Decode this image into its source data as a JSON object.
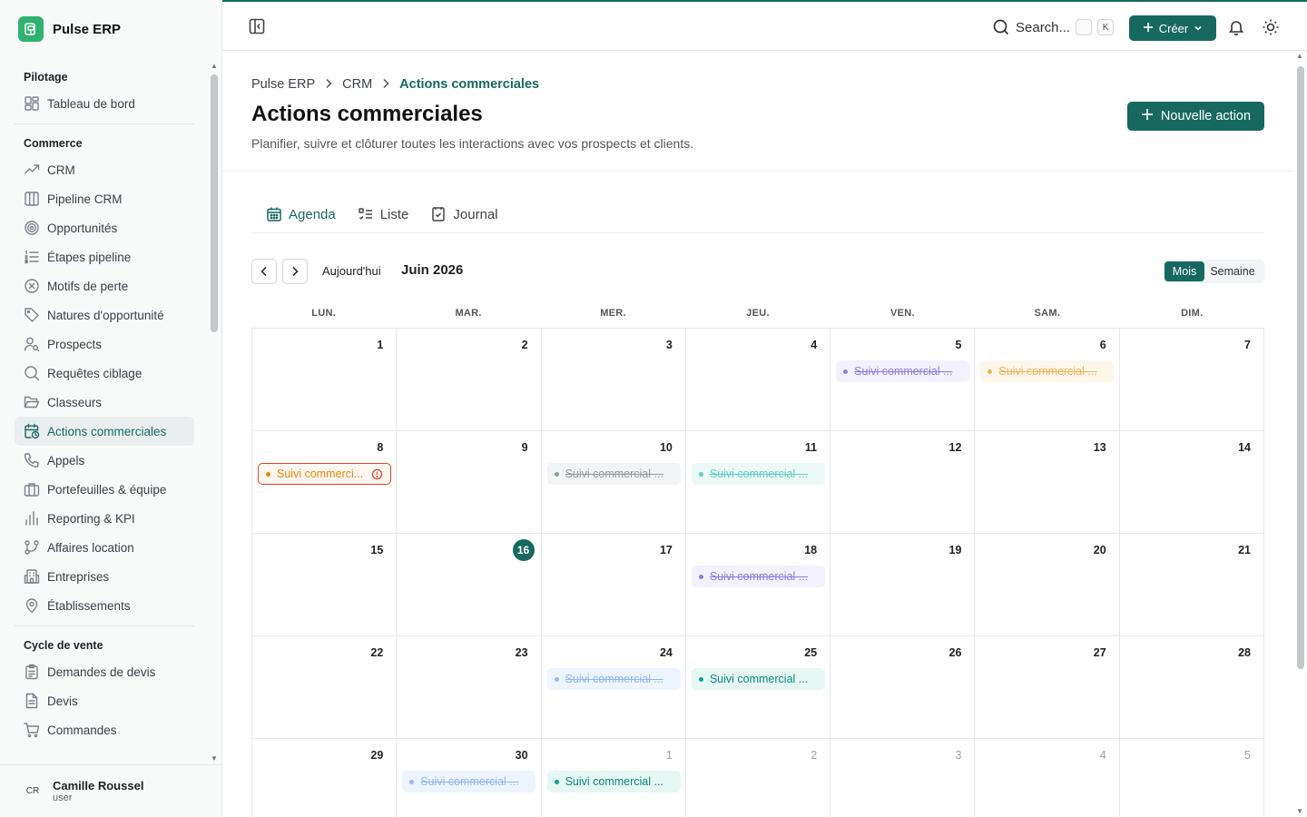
{
  "app": {
    "name": "Pulse ERP"
  },
  "sidebar": {
    "sections": [
      {
        "title": "Pilotage",
        "items": [
          {
            "label": "Tableau de bord",
            "icon": "dashboard-icon"
          }
        ]
      },
      {
        "title": "Commerce",
        "items": [
          {
            "label": "CRM",
            "icon": "trending-up-icon"
          },
          {
            "label": "Pipeline CRM",
            "icon": "kanban-icon"
          },
          {
            "label": "Opportunités",
            "icon": "target-icon"
          },
          {
            "label": "Étapes pipeline",
            "icon": "list-ordered-icon"
          },
          {
            "label": "Motifs de perte",
            "icon": "circle-x-icon"
          },
          {
            "label": "Natures d'opportunité",
            "icon": "tag-icon"
          },
          {
            "label": "Prospects",
            "icon": "user-search-icon"
          },
          {
            "label": "Requêtes ciblage",
            "icon": "search-icon"
          },
          {
            "label": "Classeurs",
            "icon": "folder-open-icon"
          },
          {
            "label": "Actions commerciales",
            "icon": "calendar-clock-icon",
            "active": true
          },
          {
            "label": "Appels",
            "icon": "phone-icon"
          },
          {
            "label": "Portefeuilles & équipe",
            "icon": "briefcase-icon"
          },
          {
            "label": "Reporting & KPI",
            "icon": "bar-chart-icon"
          },
          {
            "label": "Affaires location",
            "icon": "git-branch-icon"
          },
          {
            "label": "Entreprises",
            "icon": "building-icon"
          },
          {
            "label": "Établissements",
            "icon": "map-pin-icon"
          }
        ]
      },
      {
        "title": "Cycle de vente",
        "items": [
          {
            "label": "Demandes de devis",
            "icon": "clipboard-list-icon"
          },
          {
            "label": "Devis",
            "icon": "file-text-icon"
          },
          {
            "label": "Commandes",
            "icon": "shopping-cart-icon"
          }
        ]
      }
    ],
    "user": {
      "initials": "CR",
      "name": "Camille Roussel",
      "role": "user"
    }
  },
  "topbar": {
    "search_label": "Search...",
    "search_kbd": "K",
    "create_label": "Créer"
  },
  "header": {
    "breadcrumb": [
      "Pulse ERP",
      "CRM",
      "Actions commerciales"
    ],
    "title": "Actions commerciales",
    "subtitle": "Planifier, suivre et clôturer toutes les interactions avec vos prospects et clients.",
    "new_action_label": "Nouvelle action"
  },
  "tabs": [
    {
      "label": "Agenda",
      "icon": "calendar-icon",
      "active": true
    },
    {
      "label": "Liste",
      "icon": "list-checks-icon",
      "active": false
    },
    {
      "label": "Journal",
      "icon": "notebook-icon",
      "active": false
    }
  ],
  "calendar": {
    "today_label": "Aujourd'hui",
    "month_label": "Juin 2026",
    "views": [
      {
        "label": "Mois",
        "active": true
      },
      {
        "label": "Semaine",
        "active": false
      }
    ],
    "weekdays": [
      "LUN.",
      "MAR.",
      "MER.",
      "JEU.",
      "VEN.",
      "SAM.",
      "DIM."
    ],
    "days": [
      {
        "n": "1"
      },
      {
        "n": "2"
      },
      {
        "n": "3"
      },
      {
        "n": "4"
      },
      {
        "n": "5",
        "event": {
          "label": "Suivi commercial ...",
          "color": "#8b7fe0",
          "bg": "#f3f1fd",
          "done": true
        }
      },
      {
        "n": "6",
        "event": {
          "label": "Suivi commercial ...",
          "color": "#f0b35a",
          "bg": "#fdf6ea",
          "done": true
        }
      },
      {
        "n": "7"
      },
      {
        "n": "8",
        "event": {
          "label": "Suivi commerci...",
          "color": "#e58a0a",
          "bg": "#fff6f1",
          "border": "#e0442c",
          "done": false,
          "overdue": true
        }
      },
      {
        "n": "9"
      },
      {
        "n": "10",
        "event": {
          "label": "Suivi commercial ...",
          "color": "#8f9aa2",
          "bg": "#f1f3f4",
          "done": true
        }
      },
      {
        "n": "11",
        "event": {
          "label": "Suivi commercial ...",
          "color": "#5fd0c5",
          "bg": "#edf9f7",
          "done": true
        }
      },
      {
        "n": "12"
      },
      {
        "n": "13"
      },
      {
        "n": "14"
      },
      {
        "n": "15"
      },
      {
        "n": "16",
        "today": true
      },
      {
        "n": "17"
      },
      {
        "n": "18",
        "event": {
          "label": "Suivi commercial ...",
          "color": "#8b7fe0",
          "bg": "#f3f1fd",
          "done": true
        }
      },
      {
        "n": "19"
      },
      {
        "n": "20"
      },
      {
        "n": "21"
      },
      {
        "n": "22"
      },
      {
        "n": "23"
      },
      {
        "n": "24",
        "event": {
          "label": "Suivi commercial ...",
          "color": "#90b9f0",
          "bg": "#eef4fd",
          "done": true
        }
      },
      {
        "n": "25",
        "event": {
          "label": "Suivi commercial ...",
          "color": "#0f9f8f",
          "bg": "#e6f6f3",
          "done": false
        }
      },
      {
        "n": "26"
      },
      {
        "n": "27"
      },
      {
        "n": "28"
      },
      {
        "n": "29"
      },
      {
        "n": "30",
        "event": {
          "label": "Suivi commercial ...",
          "color": "#90b9f0",
          "bg": "#eef4fd",
          "done": true
        }
      },
      {
        "n": "1",
        "other": true,
        "event": {
          "label": "Suivi commercial ...",
          "color": "#0f9f8f",
          "bg": "#e6f6f3",
          "done": false
        }
      },
      {
        "n": "2",
        "other": true
      },
      {
        "n": "3",
        "other": true
      },
      {
        "n": "4",
        "other": true
      },
      {
        "n": "5",
        "other": true
      }
    ]
  },
  "colors": {
    "accent": "#17695f",
    "brand_logo": "#2fb36f"
  }
}
